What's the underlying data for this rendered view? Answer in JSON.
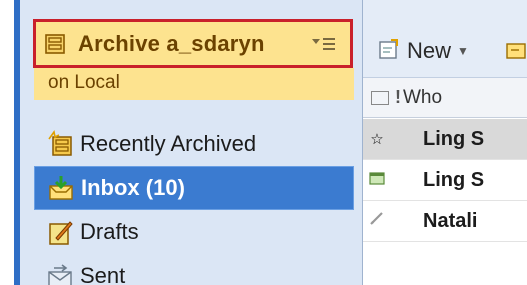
{
  "archive": {
    "title": "Archive a_sdaryn",
    "subtitle": "on Local"
  },
  "nav": {
    "items": [
      {
        "label": "Recently Archived",
        "icon": "recent-archive-icon"
      },
      {
        "label": "Inbox (10)",
        "icon": "inbox-icon",
        "selected": true
      },
      {
        "label": "Drafts",
        "icon": "drafts-icon"
      },
      {
        "label": "Sent",
        "icon": "sent-icon"
      }
    ]
  },
  "toolbar": {
    "new_label": "New"
  },
  "list": {
    "who_header": "Who",
    "rows": [
      {
        "from": "Ling S",
        "icon": "star-icon",
        "selected": true
      },
      {
        "from": "Ling S",
        "icon": "calendar-icon"
      },
      {
        "from": "Natali",
        "icon": "reply-icon"
      }
    ]
  },
  "colors": {
    "header_bg": "#fde38f",
    "header_border": "#c9202b",
    "selection_bg": "#3b7bd0",
    "sidebar_bg": "#dbe6f5"
  }
}
